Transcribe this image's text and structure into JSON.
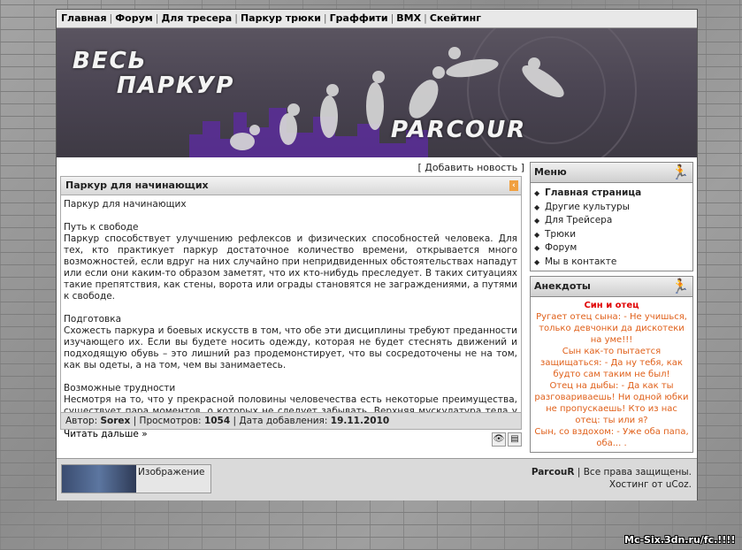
{
  "nav": [
    "Главная",
    "Форум",
    "Для тресера",
    "Паркур трюки",
    "Граффити",
    "BMX",
    "Скейтинг"
  ],
  "banner": {
    "title_line1": "ВЕСЬ",
    "title_line2": "ПАРКУР",
    "title_line3": "PARCOUR"
  },
  "add_news": "Добавить новость",
  "article": {
    "title": "Паркур для начинающих",
    "p0": "Паркур для начинающих",
    "p1_head": "Путь к свободе",
    "p1": "Паркур способствует улучшению рефлексов и физических способностей человека. Для тех, кто практикует паркур достаточное количество времени, открывается много возможностей, если вдруг на них случайно при непридвиденных обстоятельствах нападут или если они каким-то образом заметят, что их кто-нибудь преследует. В таких ситуациях такие препятствия, как стены, ворота или ограды становятся не заграждениями, а путями к свободе.",
    "p2_head": "Подготовка",
    "p2": "Схожесть паркура и боевых искусств в том, что обе эти дисциплины требуют преданности изучающего их. Если вы будете носить одежду, которая не будет стеснять движений и подходящую обувь – это лишний раз продемонстирует, что вы сосредоточены не на том, как вы одеты, а на том, чем вы занимаетесь.",
    "p3_head": "Возможные трудности",
    "p3": "Несмотря на то, что у прекрасной половины человечества есть некоторые преимущества, существует пара моментов, о которых не следует забывать. Верхняя мускулатура тела у мужчин развита ...",
    "read_more": "Читать дальше »",
    "author_label": "Автор:",
    "author": "Sorex",
    "views_label": "Просмотров:",
    "views": "1054",
    "date_label": "Дата добавления:",
    "date": "19.11.2010"
  },
  "sidebar": {
    "menu_title": "Меню",
    "menu": [
      "Главная страница",
      "Другие культуры",
      "Для Трейсера",
      "Трюки",
      "Форум",
      "Мы в контакте"
    ],
    "jokes_title": "Анекдоты",
    "joke_title": "Син и отец",
    "joke_lines": [
      "Ругает отец сына: - Не учишься, только девчонки да дискотеки на уме!!!",
      "Сын как-то пытается защищаться: - Да ну тебя, как будто сам таким не был!",
      "Отец на дыбы: - Да как ты разговариваешь! Ни одной юбки не пропускаешь! Кто из нас отец: ты или я?",
      "Сын, со вздохом: - Уже оба папа, оба... ."
    ]
  },
  "footer": {
    "image_label": "Изображение",
    "site": "ParcouR",
    "rights": "Все права защищены.",
    "hosting": "Хостинг от uCoz."
  },
  "watermark": "Mc-Six.3dn.ru/fc.!!!!"
}
